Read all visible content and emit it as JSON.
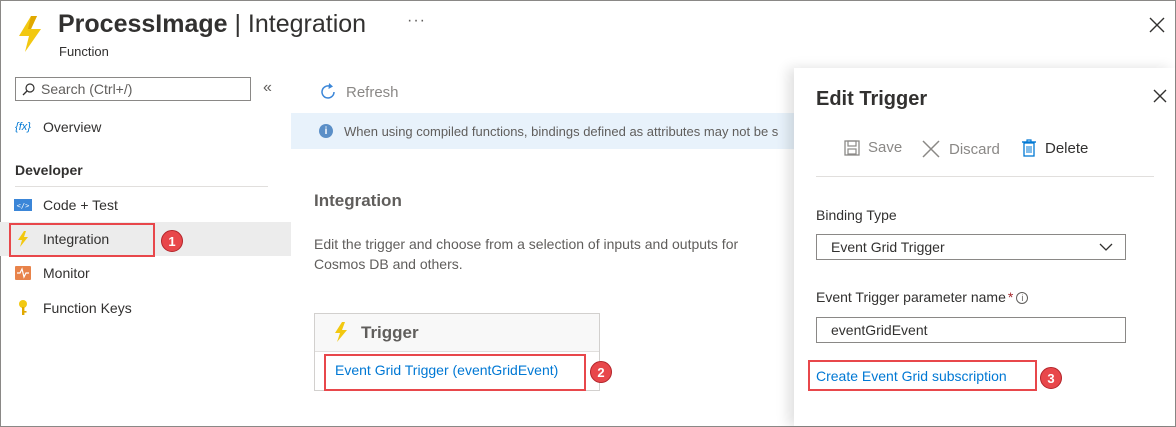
{
  "header": {
    "title_bold": "ProcessImage",
    "title_rest": " | Integration",
    "subtitle": "Function",
    "more": "···"
  },
  "sidebar": {
    "search_placeholder": "Search (Ctrl+/)",
    "collapse_glyph": "«",
    "overview_label": "Overview",
    "section_label": "Developer",
    "items": [
      {
        "label": "Code + Test",
        "icon": "code-icon"
      },
      {
        "label": "Integration",
        "icon": "lightning-icon",
        "selected": true
      },
      {
        "label": "Monitor",
        "icon": "monitor-icon"
      },
      {
        "label": "Function Keys",
        "icon": "key-icon"
      }
    ]
  },
  "main": {
    "refresh_label": "Refresh",
    "info_text": "When using compiled functions, bindings defined as attributes may not be s",
    "heading": "Integration",
    "description_line1": "Edit the trigger and choose from a selection of inputs and outputs for",
    "description_line2": "Cosmos DB and others.",
    "trigger_card_title": "Trigger",
    "trigger_link": "Event Grid Trigger (eventGridEvent)"
  },
  "panel": {
    "title": "Edit Trigger",
    "save_label": "Save",
    "discard_label": "Discard",
    "delete_label": "Delete",
    "binding_type_label": "Binding Type",
    "binding_type_value": "Event Grid Trigger",
    "param_label": "Event Trigger parameter name",
    "param_required": "*",
    "param_value": "eventGridEvent",
    "subscription_link": "Create Event Grid subscription"
  },
  "annotations": {
    "badge1": "1",
    "badge2": "2",
    "badge3": "3"
  },
  "colors": {
    "accent": "#0078d4",
    "lightning": "#f2c811",
    "highlight": "#e8474b",
    "info_bg": "#e8f2fb"
  }
}
